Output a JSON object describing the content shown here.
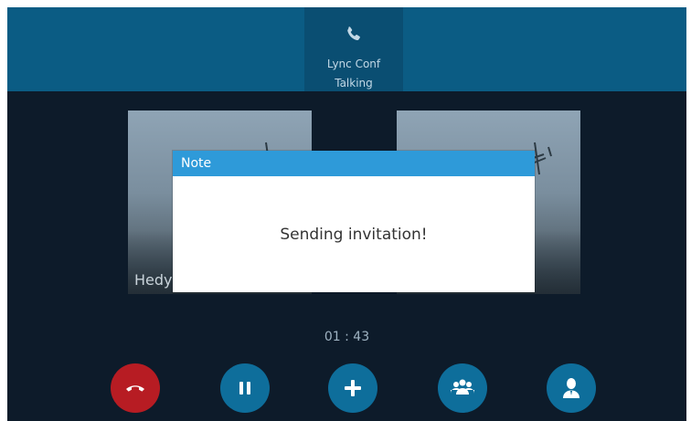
{
  "call_tab": {
    "icon": "phone-icon",
    "name": "Lync Conf",
    "status": "Talking"
  },
  "participants": [
    {
      "name": "Hedy"
    },
    {
      "name": ""
    }
  ],
  "timer": "01 : 43",
  "actions": [
    {
      "icon": "end-call-icon",
      "color": "#b71c23"
    },
    {
      "icon": "pause-icon",
      "color": "#0e6e9b"
    },
    {
      "icon": "plus-icon",
      "color": "#0e6e9b"
    },
    {
      "icon": "group-icon",
      "color": "#0e6e9b"
    },
    {
      "icon": "contact-icon",
      "color": "#0e6e9b"
    }
  ],
  "dialog": {
    "title": "Note",
    "message": "Sending invitation!"
  },
  "colors": {
    "top_bar": "#0b5c84",
    "background": "#0d1b2a",
    "dialog_header": "#2e9ad9"
  }
}
